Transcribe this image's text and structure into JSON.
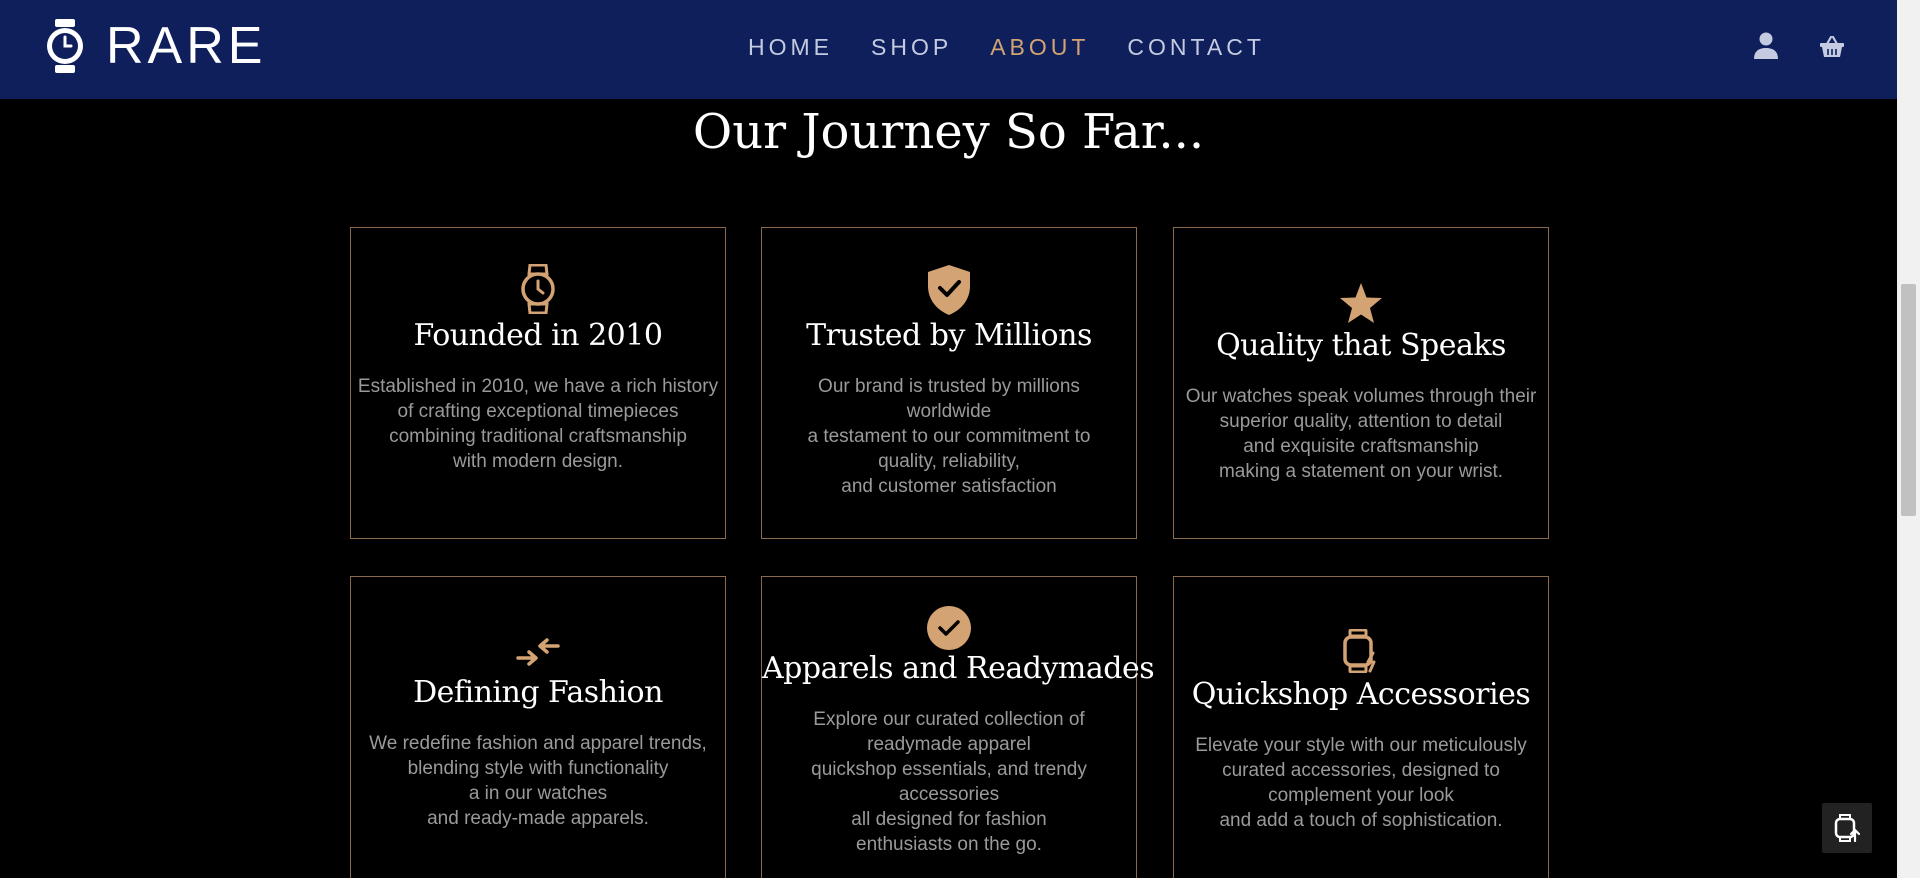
{
  "brand": {
    "name": "RARE"
  },
  "nav": {
    "items": [
      {
        "label": "HOME",
        "active": false
      },
      {
        "label": "SHOP",
        "active": false
      },
      {
        "label": "ABOUT",
        "active": true
      },
      {
        "label": "CONTACT",
        "active": false
      }
    ]
  },
  "header_icons": [
    "user-icon",
    "basket-icon"
  ],
  "section": {
    "title": "Our Journey So Far..."
  },
  "cards": [
    {
      "icon": "watch-icon",
      "title": "Founded in 2010",
      "lines": [
        "Established in 2010, we have a rich history",
        "of crafting exceptional timepieces",
        "combining traditional craftsmanship",
        "with modern design."
      ]
    },
    {
      "icon": "shield-check-icon",
      "title": "Trusted by Millions",
      "lines": [
        "Our brand is trusted by millions worldwide",
        "a testament to our commitment to quality, reliability,",
        "and customer satisfaction"
      ]
    },
    {
      "icon": "star-icon",
      "title": "Quality that Speaks",
      "lines": [
        "Our watches speak volumes through their superior quality, attention to detail",
        "and exquisite craftsmanship",
        "making a statement on your wrist."
      ]
    },
    {
      "icon": "compress-arrows-icon",
      "title": "Defining Fashion",
      "lines": [
        "We redefine fashion and apparel trends, blending style with functionality",
        "a in our watches",
        "and ready-made apparels."
      ]
    },
    {
      "icon": "check-circle-icon",
      "title": "Apparels and Readymades",
      "lines": [
        "Explore our curated collection of readymade apparel",
        "quickshop essentials, and trendy accessories",
        "all designed for fashion enthusiasts on the go."
      ]
    },
    {
      "icon": "smartwatch-bolt-icon",
      "title": "Quickshop Accessories",
      "lines": [
        "Elevate your style with our meticulously curated accessories, designed to complement your look",
        "and add a touch of sophistication."
      ]
    }
  ],
  "colors": {
    "header_bg": "#0e1f5c",
    "accent": "#d4a373",
    "page_bg": "#000000",
    "body_text": "#9a9a9a"
  }
}
